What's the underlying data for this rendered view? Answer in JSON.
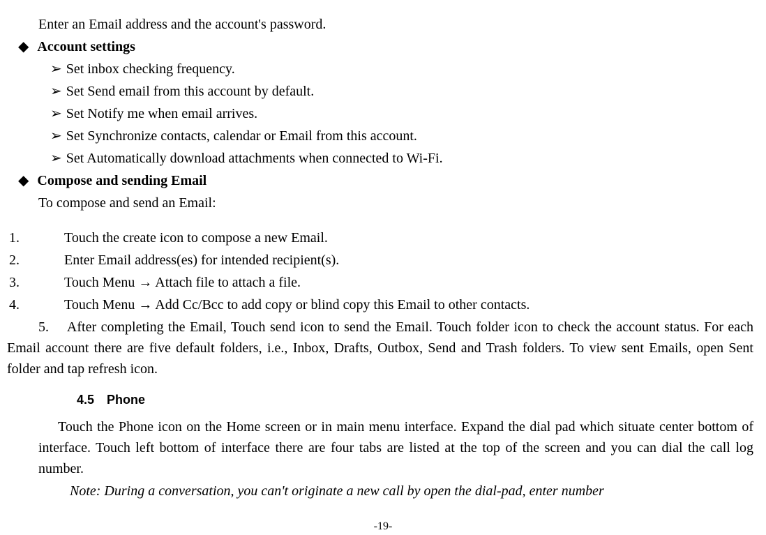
{
  "intro": "Enter an Email address and the account's password.",
  "sections": {
    "account_settings": {
      "heading": "Account settings",
      "items": [
        "Set inbox checking frequency.",
        "Set Send email from this account by default.",
        "Set Notify me when email arrives.",
        "Set Synchronize contacts, calendar or Email from this account.",
        "Set Automatically download attachments when connected to Wi-Fi."
      ]
    },
    "compose": {
      "heading": "Compose and sending Email",
      "intro": "To compose and send an Email:",
      "steps": [
        "Touch the create icon to compose a new Email.",
        "Enter Email address(es) for intended recipient(s).",
        "Touch Menu  →  Attach file to attach a file.",
        "Touch Menu  →  Add Cc/Bcc to add copy or blind copy this Email to other contacts.",
        "After completing the Email, Touch send icon to send the Email. Touch folder icon to check the account status. For each Email account there are five default folders, i.e., Inbox, Drafts, Outbox, Send and Trash folders. To view sent Emails, open Sent folder and tap refresh icon."
      ]
    }
  },
  "phone_section": {
    "number": "4.5",
    "title": "Phone",
    "para": "Touch the Phone icon on the Home screen or in main menu interface. Expand the dial pad which situate center bottom of interface. Touch left bottom of interface there are four tabs are listed at the top of the screen and you can dial the call log number.",
    "note": "Note: During a conversation, you can't originate a new call by open the dial-pad, enter number"
  },
  "page_number": "-19-",
  "glyphs": {
    "diamond": "◆",
    "arrow": "➢"
  }
}
